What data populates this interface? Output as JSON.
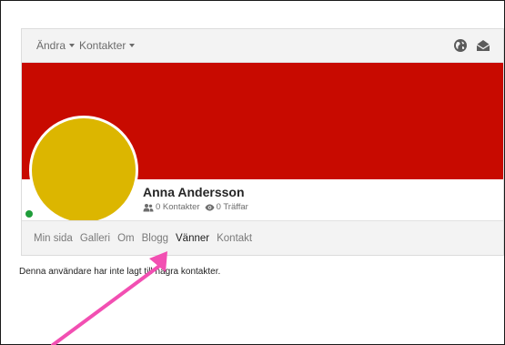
{
  "topbar": {
    "menus": [
      {
        "label": "Ändra"
      },
      {
        "label": "Kontakter"
      }
    ],
    "icons": [
      "globe-icon",
      "envelope-open-icon"
    ]
  },
  "profile": {
    "name": "Anna Andersson",
    "contacts_text": "0 Kontakter",
    "hits_text": "0 Träffar",
    "status": "online",
    "colors": {
      "banner": "#c80a00",
      "avatar": "#dcb600",
      "online": "#1f9d3a"
    }
  },
  "tabs": [
    {
      "label": "Min sida",
      "active": false
    },
    {
      "label": "Galleri",
      "active": false
    },
    {
      "label": "Om",
      "active": false
    },
    {
      "label": "Blogg",
      "active": false
    },
    {
      "label": "Vänner",
      "active": true
    },
    {
      "label": "Kontakt",
      "active": false
    }
  ],
  "content": {
    "message": "Denna användare har inte lagt till några kontakter."
  },
  "annotation": {
    "color": "#f24fb2"
  }
}
